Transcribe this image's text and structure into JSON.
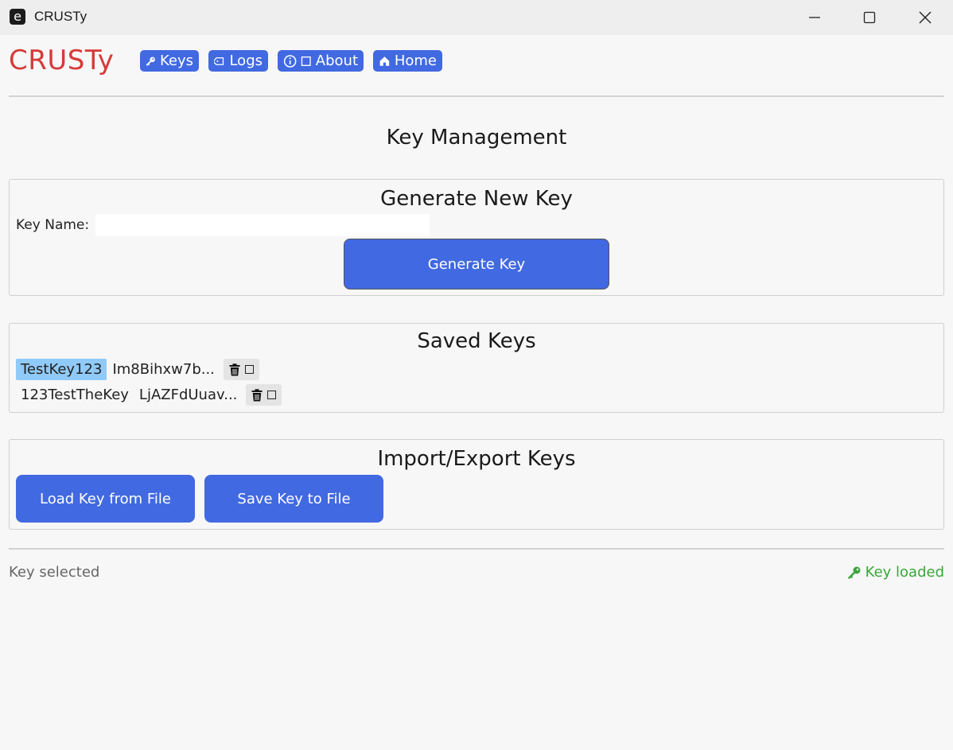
{
  "window": {
    "app_icon_letter": "e",
    "title": "CRUSTy"
  },
  "header": {
    "brand": "CRUSTy",
    "nav": {
      "keys": "Keys",
      "logs": "Logs",
      "about": "About",
      "home": "Home"
    }
  },
  "page_title": "Key Management",
  "generate": {
    "title": "Generate New Key",
    "key_name_label": "Key Name:",
    "key_name_value": "",
    "button": "Generate Key"
  },
  "saved": {
    "title": "Saved Keys",
    "keys": [
      {
        "name": "TestKey123",
        "value": "Im8Bihxw7b...",
        "selected": true
      },
      {
        "name": "123TestTheKey",
        "value": "LjAZFdUuav...",
        "selected": false
      }
    ]
  },
  "io": {
    "title": "Import/Export Keys",
    "load": "Load Key from File",
    "save": "Save Key to File"
  },
  "status": {
    "left": "Key selected",
    "right": "Key loaded"
  },
  "colors": {
    "accent": "#4169e1",
    "brand": "#d63a3a",
    "selected": "#90caf9",
    "success": "#3aa63a"
  }
}
